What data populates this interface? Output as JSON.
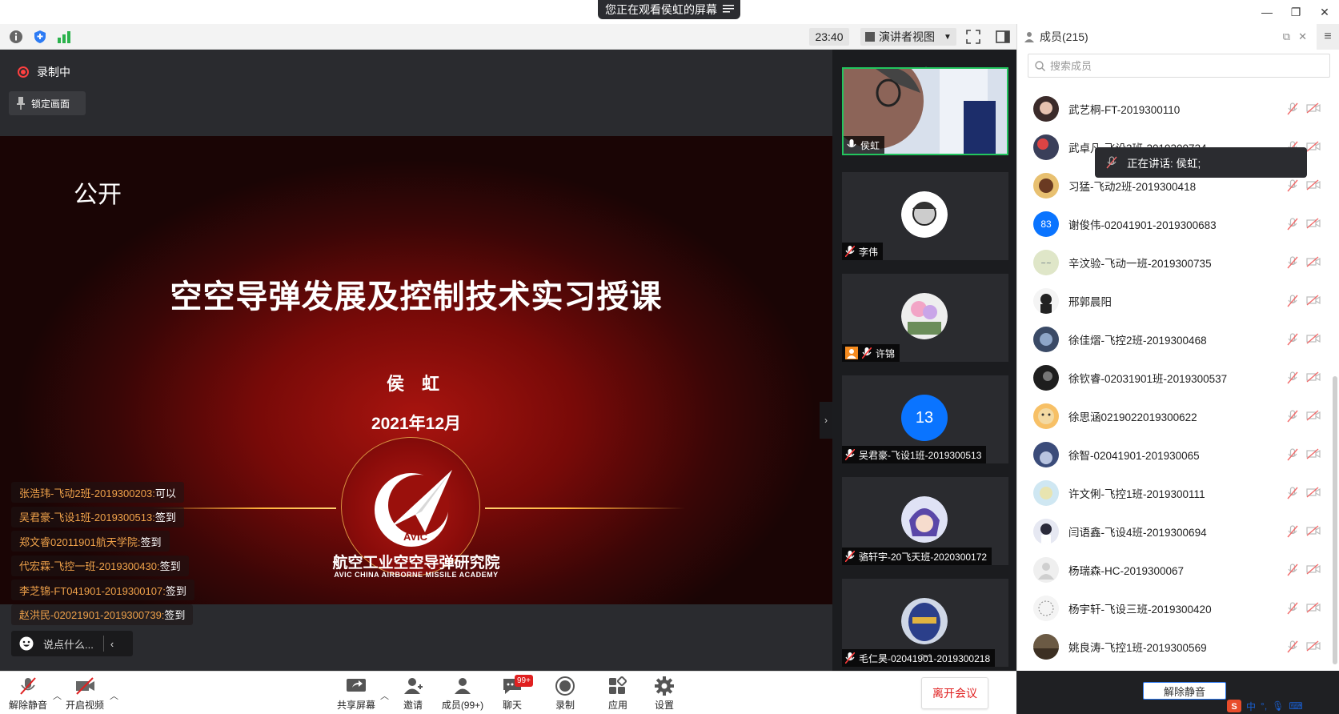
{
  "titlebar": {
    "share_notice": "您正在观看侯虹的屏幕"
  },
  "toolbar": {
    "time": "23:40",
    "view_mode": "演讲者视图"
  },
  "stage": {
    "recording_label": "录制中",
    "lock_label": "锁定画面"
  },
  "slide": {
    "public_label": "公开",
    "title": "空空导弹发展及控制技术实习授课",
    "author": "侯 虹",
    "date": "2021年12月",
    "logo_text": "AVIC",
    "org_cn": "航空工业空空导弹研究院",
    "org_en": "AVIC CHINA AIRBORNE  MISSILE ACADEMY"
  },
  "chat": {
    "messages": [
      {
        "who": "张浩玮-飞动2班-2019300203:",
        "text": " 可以"
      },
      {
        "who": "吴君豪-飞设1班-2019300513:",
        "text": " 签到"
      },
      {
        "who": "郑文睿02011901航天学院:",
        "text": " 签到"
      },
      {
        "who": "代宏霖-飞控一班-2019300430:",
        "text": " 签到"
      },
      {
        "who": "李芝锦-FT041901-2019300107:",
        "text": " 签到"
      },
      {
        "who": "赵洪民-02021901-2019300739:",
        "text": " 签到"
      }
    ],
    "input_placeholder": "说点什么..."
  },
  "videos": [
    {
      "name": "侯虹"
    },
    {
      "name": "李伟"
    },
    {
      "name": "许锦"
    },
    {
      "name": "吴君豪-飞设1班-2019300513",
      "avatar_text": "13"
    },
    {
      "name": "骆轩宇-20飞天班-2020300172"
    },
    {
      "name": "毛仁昊-02041901-2019300218"
    }
  ],
  "panel": {
    "title": "成员(215)",
    "search_placeholder": "搜索成员",
    "speaking": "正在讲话: 侯虹;",
    "unmute_all": "解除静音",
    "members": [
      {
        "name": "武艺桐-FT-2019300110"
      },
      {
        "name": "武卓凡-飞设3班-2019300734"
      },
      {
        "name": "习猛-飞动2班-2019300418"
      },
      {
        "name": "谢俊伟-02041901-2019300683",
        "avatar_text": "83"
      },
      {
        "name": "辛汶验-飞动一班-2019300735"
      },
      {
        "name": "邢郭晨阳"
      },
      {
        "name": "徐佳熠-飞控2班-2019300468"
      },
      {
        "name": "徐钦睿-02031901班-2019300537"
      },
      {
        "name": "徐思涵0219022019300622"
      },
      {
        "name": "徐智-02041901-201930065"
      },
      {
        "name": "许文俐-飞控1班-2019300111"
      },
      {
        "name": "闫语鑫-飞设4班-2019300694"
      },
      {
        "name": "杨瑞森-HC-2019300067"
      },
      {
        "name": "杨宇轩-飞设三班-2019300420"
      },
      {
        "name": "姚良涛-飞控1班-2019300569"
      }
    ]
  },
  "bottombar": {
    "unmute": "解除静音",
    "start_video": "开启视频",
    "share_screen": "共享屏幕",
    "invite": "邀请",
    "members": "成员(99+)",
    "chat": "聊天",
    "chat_badge": "99+",
    "record": "录制",
    "apps": "应用",
    "settings": "设置",
    "leave": "离开会议"
  },
  "ime": {
    "label": "中"
  },
  "colors": {
    "accent_blue": "#0a74ff",
    "speaking_green": "#22c55e",
    "leave_red": "#e02020",
    "chat_name_orange": "#f0a24a"
  }
}
